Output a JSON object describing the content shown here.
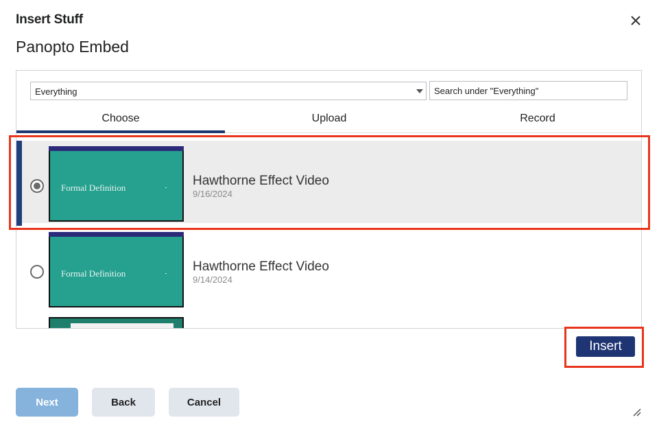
{
  "dialog": {
    "title": "Insert Stuff",
    "subtitle": "Panopto Embed"
  },
  "filter": {
    "folder_value": "Everything",
    "search_placeholder": "Search under \"Everything\""
  },
  "tabs": [
    {
      "label": "Choose",
      "active": true
    },
    {
      "label": "Upload",
      "active": false
    },
    {
      "label": "Record",
      "active": false
    }
  ],
  "items": [
    {
      "title": "Hawthorne Effect Video",
      "date": "9/16/2024",
      "selected": true,
      "thumb_text": "Formal Definition"
    },
    {
      "title": "Hawthorne Effect Video",
      "date": "9/14/2024",
      "selected": false,
      "thumb_text": "Formal Definition"
    }
  ],
  "actions": {
    "insert_label": "Insert"
  },
  "footer": {
    "next_label": "Next",
    "back_label": "Back",
    "cancel_label": "Cancel"
  },
  "icons": {
    "close": "close-icon",
    "dropdown": "chevron-down-icon",
    "resize": "resize-handle-icon"
  },
  "colors": {
    "accent": "#1f3472",
    "selection_bar": "#213f7d",
    "highlight": "#e8341c",
    "thumb_slide": "#26a08f"
  }
}
